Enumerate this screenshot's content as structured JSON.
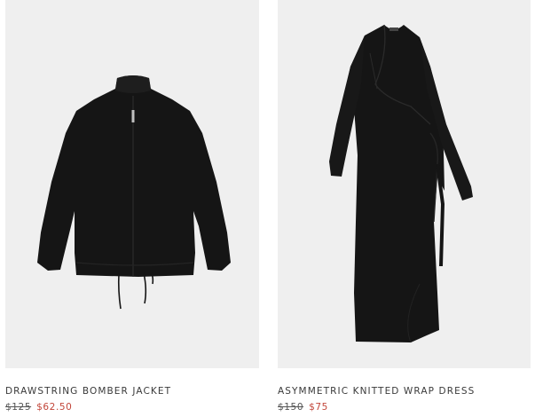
{
  "colors": {
    "image_background": "#efefef",
    "garment": "#151515",
    "sale_price": "#c2463a",
    "text": "#3a3a3a"
  },
  "products": [
    {
      "name": "DRAWSTRING BOMBER JACKET",
      "original_price": "$125",
      "sale_price": "$62.50"
    },
    {
      "name": "ASYMMETRIC KNITTED WRAP DRESS",
      "original_price": "$150",
      "sale_price": "$75"
    }
  ]
}
